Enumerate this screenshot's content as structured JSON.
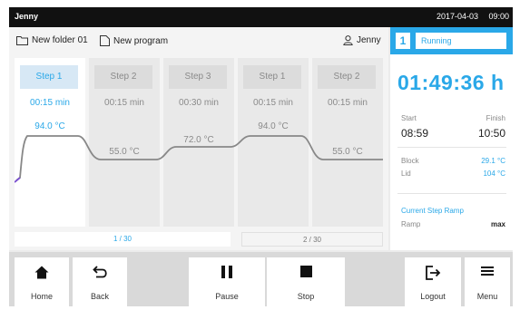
{
  "status_bar": {
    "user": "Jenny",
    "date": "2017-04-03",
    "time": "09:00"
  },
  "toolbar": {
    "folder": "New folder 01",
    "program": "New program",
    "user": "Jenny"
  },
  "steps": [
    {
      "label": "Step 1",
      "duration": "00:15 min",
      "temperature": "94.0 °C",
      "active": true
    },
    {
      "label": "Step 2",
      "duration": "00:15 min",
      "temperature": "55.0 °C",
      "active": false
    },
    {
      "label": "Step 3",
      "duration": "00:30 min",
      "temperature": "72.0 °C",
      "active": false
    },
    {
      "label": "Step 1",
      "duration": "00:15 min",
      "temperature": "94.0 °C",
      "active": false
    },
    {
      "label": "Step 2",
      "duration": "00:15 min",
      "temperature": "55.0 °C",
      "active": false
    }
  ],
  "pages": [
    "1 / 30",
    "2 / 30"
  ],
  "run": {
    "number": "1",
    "status": "Running",
    "remaining": "01:49:36 h",
    "start_label": "Start",
    "finish_label": "Finish",
    "start": "08:59",
    "finish": "10:50",
    "block_label": "Block",
    "block": "29.1 °C",
    "lid_label": "Lid",
    "lid": "104 °C",
    "ramp_title": "Current Step Ramp",
    "ramp_label": "Ramp",
    "ramp": "max"
  },
  "nav": {
    "home": "Home",
    "back": "Back",
    "pause": "Pause",
    "stop": "Stop",
    "logout": "Logout",
    "menu": "Menu"
  },
  "colors": {
    "accent": "#2aa8e8",
    "statusbar": "#111111",
    "curve": "#888888"
  }
}
